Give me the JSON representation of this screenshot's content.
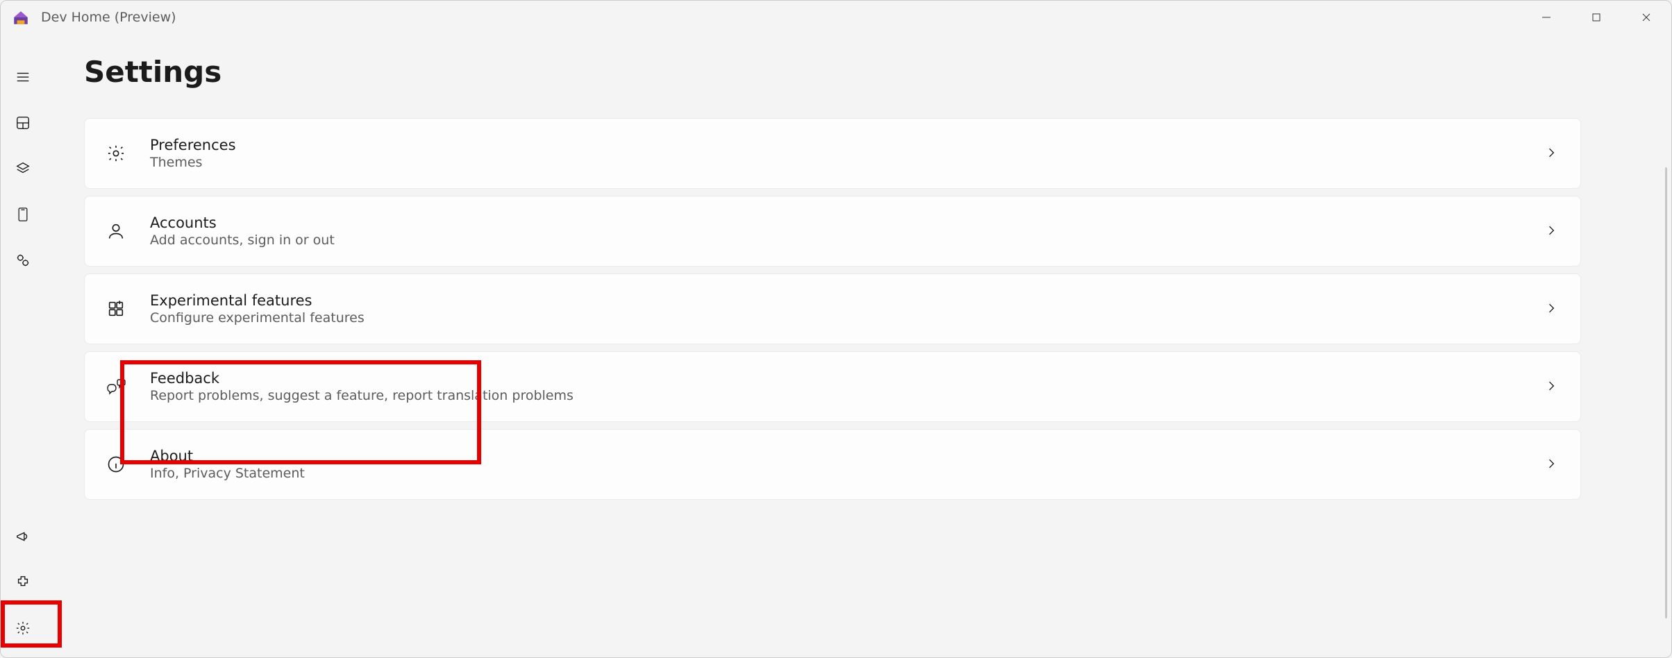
{
  "window": {
    "title": "Dev Home (Preview)"
  },
  "page": {
    "title": "Settings"
  },
  "settings_items": [
    {
      "icon": "gear-icon",
      "title": "Preferences",
      "subtitle": "Themes"
    },
    {
      "icon": "person-icon",
      "title": "Accounts",
      "subtitle": "Add accounts, sign in or out"
    },
    {
      "icon": "flask-icon",
      "title": "Experimental features",
      "subtitle": "Configure experimental features"
    },
    {
      "icon": "feedback-icon",
      "title": "Feedback",
      "subtitle": "Report problems, suggest a feature, report translation problems"
    },
    {
      "icon": "info-icon",
      "title": "About",
      "subtitle": "Info, Privacy Statement"
    }
  ],
  "nav": {
    "top": [
      {
        "name": "hamburger-icon"
      },
      {
        "name": "dashboard-icon"
      },
      {
        "name": "layers-icon"
      },
      {
        "name": "device-icon"
      },
      {
        "name": "gears-icon"
      }
    ],
    "bottom": [
      {
        "name": "announcement-icon"
      },
      {
        "name": "extension-icon"
      },
      {
        "name": "settings-icon",
        "active": true
      }
    ]
  }
}
